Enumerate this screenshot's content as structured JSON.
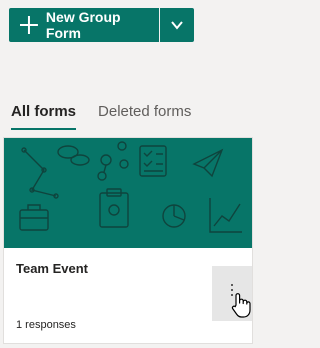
{
  "toolbar": {
    "new_button_label": "New Group Form",
    "plus_icon": "plus-icon",
    "dropdown_icon": "chevron-down-icon"
  },
  "tabs": [
    {
      "label": "All forms",
      "active": true
    },
    {
      "label": "Deleted forms",
      "active": false
    }
  ],
  "card": {
    "title": "Team Event",
    "responses": "1 responses",
    "more_icon": "more-vertical-icon"
  },
  "colors": {
    "accent": "#077568",
    "background": "#f3f2f1",
    "text": "#252423",
    "muted": "#605e5c"
  }
}
